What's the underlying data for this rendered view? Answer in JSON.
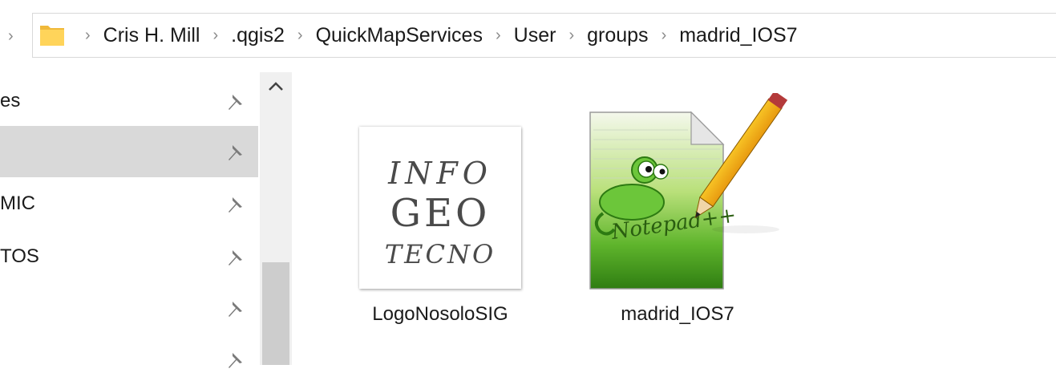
{
  "address_bar": {
    "breadcrumbs": [
      "Cris H. Mill",
      ".qgis2",
      "QuickMapServices",
      "User",
      "groups",
      "madrid_IOS7"
    ]
  },
  "nav_pane": {
    "items": [
      {
        "label": "es",
        "selected": false
      },
      {
        "label": "",
        "selected": true
      },
      {
        "label": "MIC",
        "selected": false
      },
      {
        "label": "TOS",
        "selected": false
      },
      {
        "label": "",
        "selected": false
      },
      {
        "label": "",
        "selected": false
      }
    ]
  },
  "files": [
    {
      "name": "LogoNosoloSIG",
      "icon": "image-thumbnail",
      "thumb_text": [
        "INFO",
        "GEO",
        "TECNO"
      ]
    },
    {
      "name": "madrid_IOS7",
      "icon": "notepad-plus-plus-document-icon",
      "thumb_text": "Notepad++"
    }
  ],
  "colors": {
    "selected_bg": "#d9d9d9",
    "folder_yellow": "#ffd45a",
    "chevron_gray": "#8a8a8a"
  }
}
